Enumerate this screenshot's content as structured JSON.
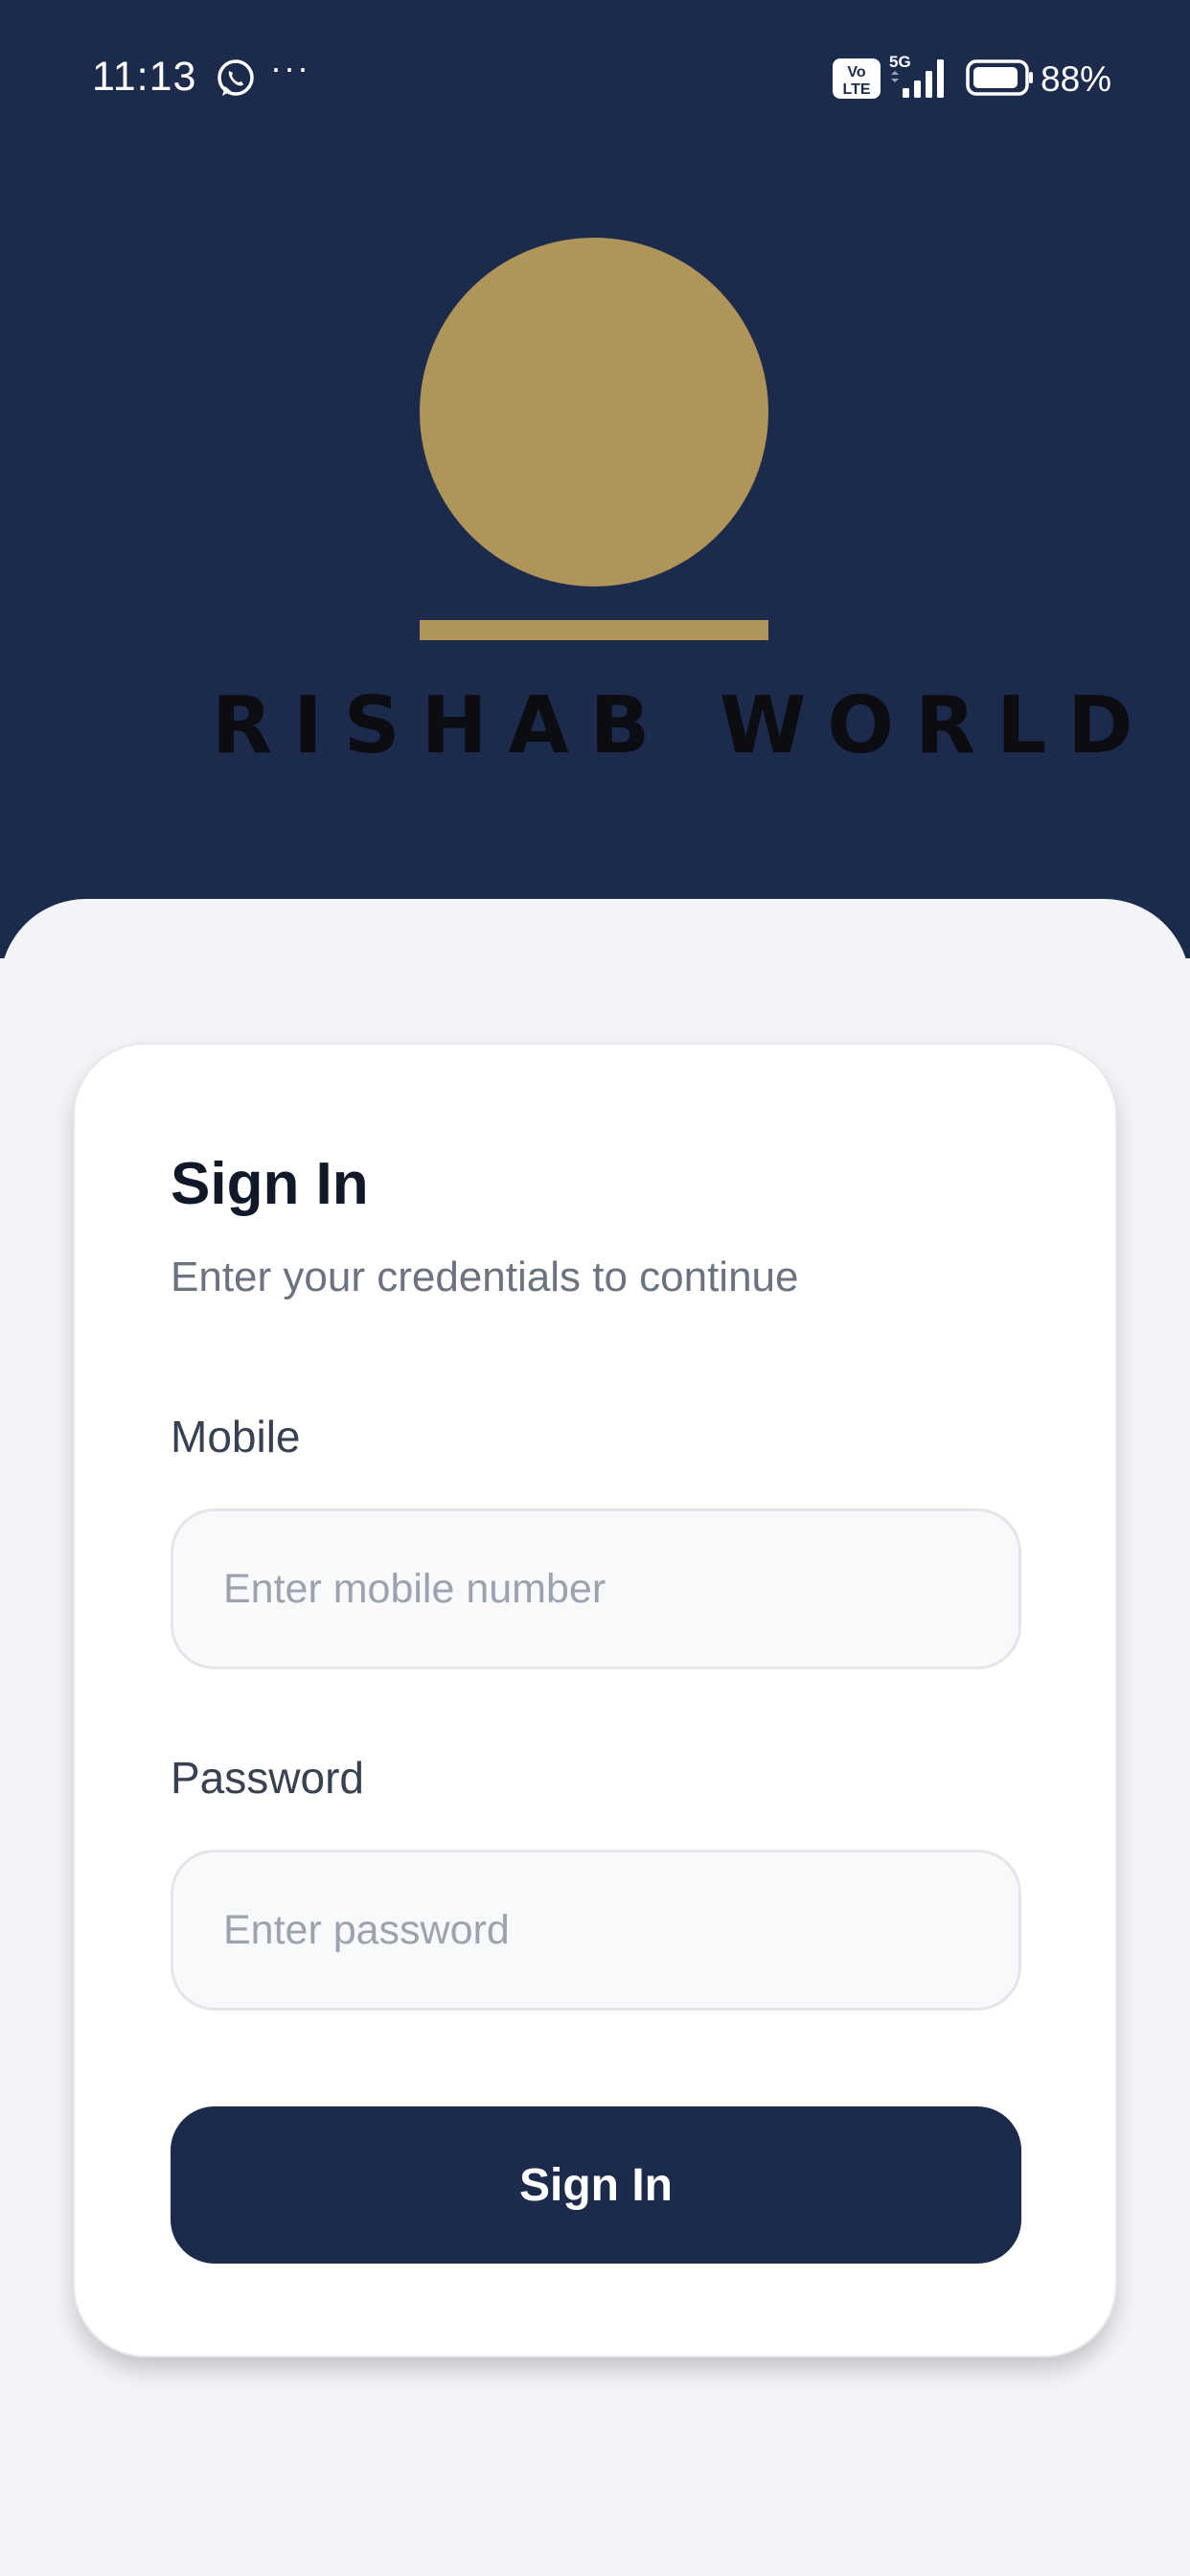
{
  "status_bar": {
    "time": "11:13",
    "more": "···",
    "network": "5G",
    "volte": "VoLTE",
    "battery_percent": "88%",
    "icons": [
      "whatsapp-icon",
      "volte-icon",
      "signal-icon",
      "battery-icon"
    ]
  },
  "brand": {
    "name": "RISHAB WORLD",
    "logo_color": "#b0955b",
    "header_color": "#1c2a4b"
  },
  "signin_card": {
    "title": "Sign In",
    "subtitle": "Enter your credentials to continue",
    "mobile_label": "Mobile",
    "mobile_placeholder": "Enter mobile number",
    "mobile_value": "",
    "password_label": "Password",
    "password_placeholder": "Enter password",
    "password_value": "",
    "submit_label": "Sign In",
    "button_color": "#1c2a4b"
  }
}
